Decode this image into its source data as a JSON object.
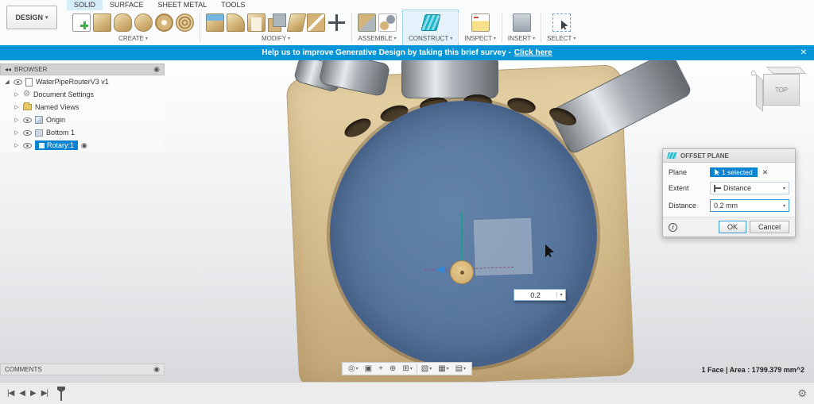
{
  "glyphs": {
    "caret": "▾",
    "close": "✕",
    "collapse": "◂◂",
    "expanded": "◢",
    "collapsed": "▷",
    "gear": "⚙",
    "target": "◉",
    "home": "⌂",
    "info": "i"
  },
  "header": {
    "design_label": "DESIGN"
  },
  "tabs": {
    "items": [
      {
        "label": "SOLID"
      },
      {
        "label": "SURFACE"
      },
      {
        "label": "SHEET METAL"
      },
      {
        "label": "TOOLS"
      }
    ]
  },
  "ribbon": {
    "groups": [
      {
        "label": "CREATE"
      },
      {
        "label": "MODIFY"
      },
      {
        "label": "ASSEMBLE"
      },
      {
        "label": "CONSTRUCT"
      },
      {
        "label": "INSPECT"
      },
      {
        "label": "INSERT"
      },
      {
        "label": "SELECT"
      }
    ]
  },
  "banner": {
    "text": "Help us to improve Generative Design by taking this brief survey -",
    "link": "Click here"
  },
  "browser": {
    "title": "BROWSER",
    "items": [
      {
        "label": "WaterPipeRouterV3 v1"
      },
      {
        "label": "Document Settings"
      },
      {
        "label": "Named Views"
      },
      {
        "label": "Origin"
      },
      {
        "label": "Bottom 1"
      },
      {
        "label": "Rotary:1"
      }
    ]
  },
  "comments": {
    "title": "COMMENTS"
  },
  "viewcube": {
    "face": "TOP"
  },
  "dialog": {
    "title": "OFFSET PLANE",
    "plane_label": "Plane",
    "plane_value": "1 selected",
    "extent_label": "Extent",
    "extent_value": "Distance",
    "distance_label": "Distance",
    "distance_value": "0.2 mm",
    "ok": "OK",
    "cancel": "Cancel"
  },
  "canvas": {
    "offset_value": "0.2",
    "status": "1 Face | Area : 1799.379 mm^2"
  },
  "nav": {
    "items": [
      {
        "glyph": "◎"
      },
      {
        "glyph": "▣"
      },
      {
        "glyph": "+"
      },
      {
        "glyph": "⊕"
      },
      {
        "glyph": "⊞"
      },
      {
        "glyph": "▧"
      },
      {
        "glyph": "▦"
      },
      {
        "glyph": "▤"
      }
    ]
  },
  "timeline": {
    "controls": [
      {
        "glyph": "|◀"
      },
      {
        "glyph": "◀"
      },
      {
        "glyph": "▶"
      },
      {
        "glyph": "▶|"
      }
    ]
  }
}
